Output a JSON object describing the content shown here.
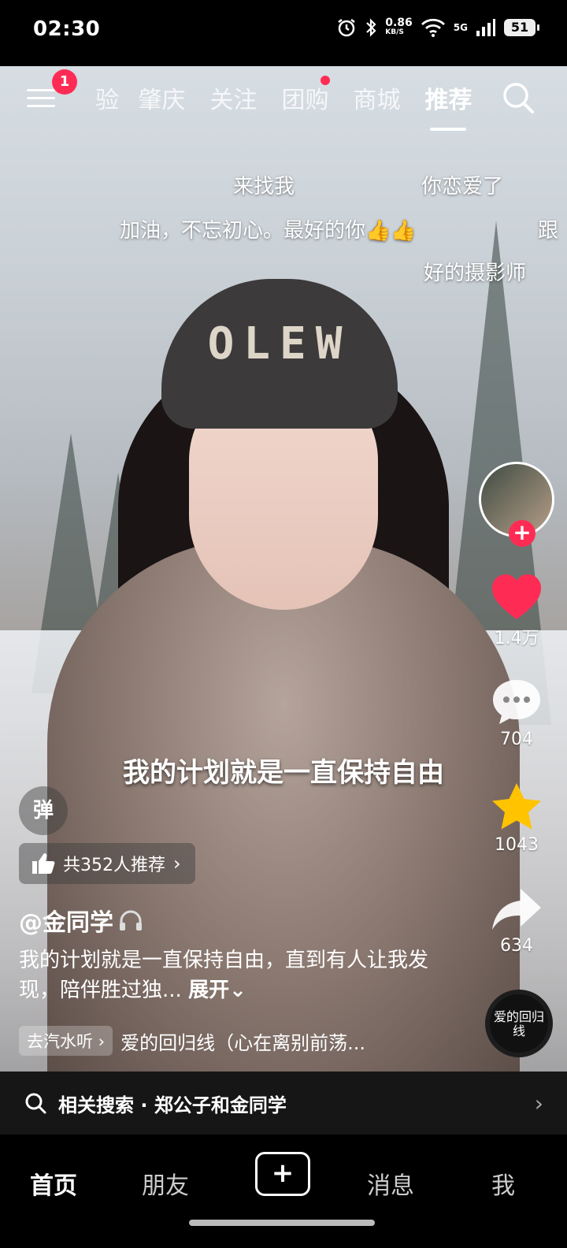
{
  "status": {
    "time": "02:30",
    "net_speed": "0.86",
    "net_speed_unit": "KB/S",
    "network": "5G",
    "battery": "51"
  },
  "topnav": {
    "menu_badge": "1",
    "tabs": [
      "验",
      "肇庆",
      "关注",
      "团购",
      "商城",
      "推荐"
    ],
    "active_tab": "推荐"
  },
  "danmaku": [
    "来找我",
    "你恋爱了",
    "加油，不忘初心。最好的你👍👍",
    "跟",
    "好的摄影师"
  ],
  "video": {
    "hat_text": "OLEW",
    "subtitle": "我的计划就是一直保持自由"
  },
  "actions": {
    "likes": "1.4万",
    "comments": "704",
    "favorites": "1043",
    "shares": "634"
  },
  "info": {
    "dan_label": "弹",
    "recommend_label": "共352人推荐",
    "author": "@金同学",
    "description": "我的计划就是一直保持自由，直到有人让我发现，陪伴胜过独...",
    "expand_label": "展开",
    "music_tag": "去汽水听",
    "music_title": "爱的回归线（心在离别前荡...",
    "disc_text": "爱的回归线"
  },
  "related": {
    "label": "相关搜索 · 郑公子和金同学"
  },
  "bottomnav": {
    "home": "首页",
    "friends": "朋友",
    "messages": "消息",
    "me": "我"
  },
  "colors": {
    "accent": "#fe2c55",
    "star": "#ffc300"
  }
}
